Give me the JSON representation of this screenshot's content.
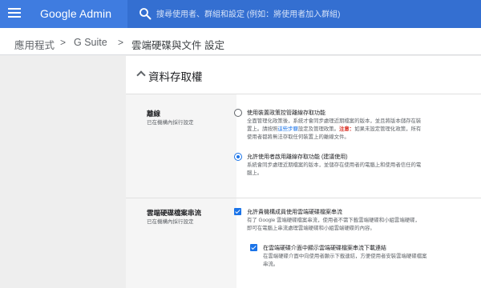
{
  "appbar": {
    "brand": "Google Admin",
    "search_placeholder": "搜尋使用者、群組和設定 (例如：將使用者加入群組)"
  },
  "breadcrumb": {
    "items": [
      "應用程式",
      "G Suite",
      "雲端硬碟與文件 設定"
    ],
    "separator": ">"
  },
  "card": {
    "title": "資料存取權",
    "sections": [
      {
        "title": "離線",
        "subtitle": "已在機構內採行設定",
        "options": [
          {
            "label": "使用裝置政策控管離線存取功能",
            "selected": false,
            "desc_line1": "全面管理化政策後，系統才會同步處理近期檔案的版本，並且將版本儲存在裝",
            "desc_line2_a": "置上。請按照",
            "desc_line2_link": "這些步驟",
            "desc_line2_b": "設定及管理政策。",
            "desc_line2_warn": "注意：",
            "desc_line2_c": "如果未設定管理化政策，所有",
            "desc_line3": "使用者都將無法存取任何裝置上的離線文件。"
          },
          {
            "label": "允許使用者啟用離線存取功能 (建議使用)",
            "selected": true,
            "desc_line1": "系統會同步處理近期檔案的版本，並儲存在使用者的電腦上和使用者信任的電",
            "desc_line2": "腦上。"
          }
        ]
      },
      {
        "title": "雲端硬碟檔案串流",
        "subtitle": "已在機構內採行設定",
        "options": [
          {
            "label": "允許貴機構成員使用雲端硬碟檔案串流",
            "checked": true,
            "desc_line1": "有了 Google 雲端硬碟檔案串流，使用者不需下載雲端硬碟和小組雲端硬碟，",
            "desc_line2": "即可在電腦上串流處理雲端硬碟和小組雲端硬碟的內容。"
          },
          {
            "label": "在雲端硬碟介面中顯示雲端硬碟檔案串流下載連結",
            "checked": true,
            "desc_line1": "在雲端硬碟介面中向使用者顯示下載連結，方便使用者安裝雲端硬碟檔案",
            "desc_line2": "串流。"
          }
        ]
      }
    ]
  }
}
